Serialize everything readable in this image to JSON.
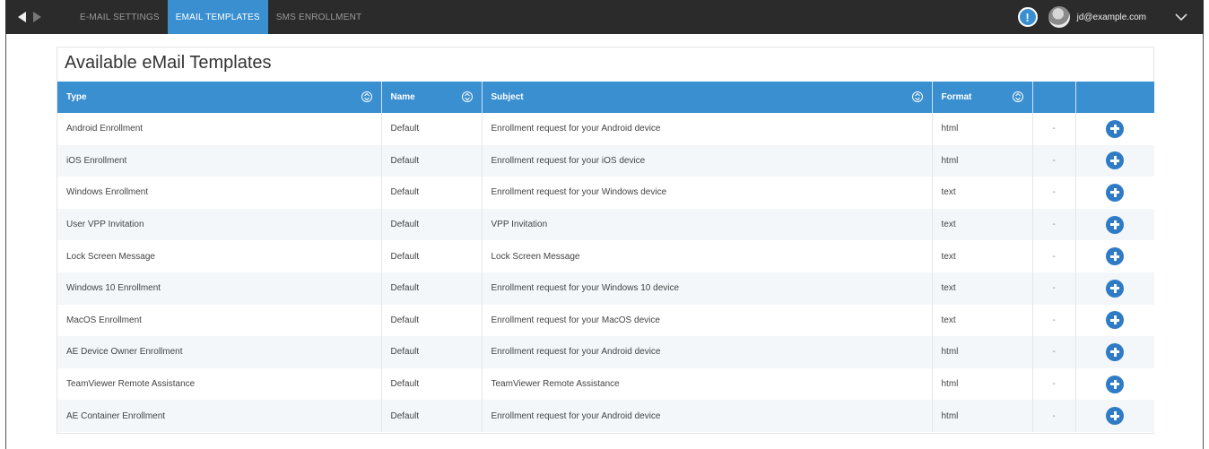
{
  "nav": {
    "tabs": [
      {
        "label": "E-MAIL SETTINGS",
        "active": false
      },
      {
        "label": "EMAIL TEMPLATES",
        "active": true
      },
      {
        "label": "SMS ENROLLMENT",
        "active": false
      }
    ],
    "alert_icon": "exclamation-icon",
    "alert_glyph": "!",
    "user_email": "jd@example.com"
  },
  "panel": {
    "title": "Available eMail Templates",
    "columns": [
      "Type",
      "Name",
      "Subject",
      "Format",
      "",
      ""
    ],
    "rows": [
      {
        "type": "Android Enrollment",
        "name": "Default",
        "subject": "Enrollment request for your Android device",
        "format": "html",
        "extra": "-"
      },
      {
        "type": "iOS Enrollment",
        "name": "Default",
        "subject": "Enrollment request for your iOS device",
        "format": "html",
        "extra": "-"
      },
      {
        "type": "Windows Enrollment",
        "name": "Default",
        "subject": "Enrollment request for your Windows device",
        "format": "text",
        "extra": "-"
      },
      {
        "type": "User VPP Invitation",
        "name": "Default",
        "subject": "VPP Invitation",
        "format": "text",
        "extra": "-"
      },
      {
        "type": "Lock Screen Message",
        "name": "Default",
        "subject": "Lock Screen Message",
        "format": "text",
        "extra": "-"
      },
      {
        "type": "Windows 10 Enrollment",
        "name": "Default",
        "subject": "Enrollment request for your Windows 10 device",
        "format": "text",
        "extra": "-"
      },
      {
        "type": "MacOS Enrollment",
        "name": "Default",
        "subject": "Enrollment request for your MacOS device",
        "format": "text",
        "extra": "-"
      },
      {
        "type": "AE Device Owner Enrollment",
        "name": "Default",
        "subject": "Enrollment request for your Android device",
        "format": "html",
        "extra": "-"
      },
      {
        "type": "TeamViewer Remote Assistance",
        "name": "Default",
        "subject": "TeamViewer Remote Assistance",
        "format": "html",
        "extra": "-"
      },
      {
        "type": "AE Container Enrollment",
        "name": "Default",
        "subject": "Enrollment request for your Android device",
        "format": "html",
        "extra": "-"
      }
    ]
  },
  "colors": {
    "accent": "#3a8fd0",
    "topbar": "#2b2b2b",
    "add_icon": "#2f7bc4",
    "row_alt": "#f3f7fa"
  }
}
